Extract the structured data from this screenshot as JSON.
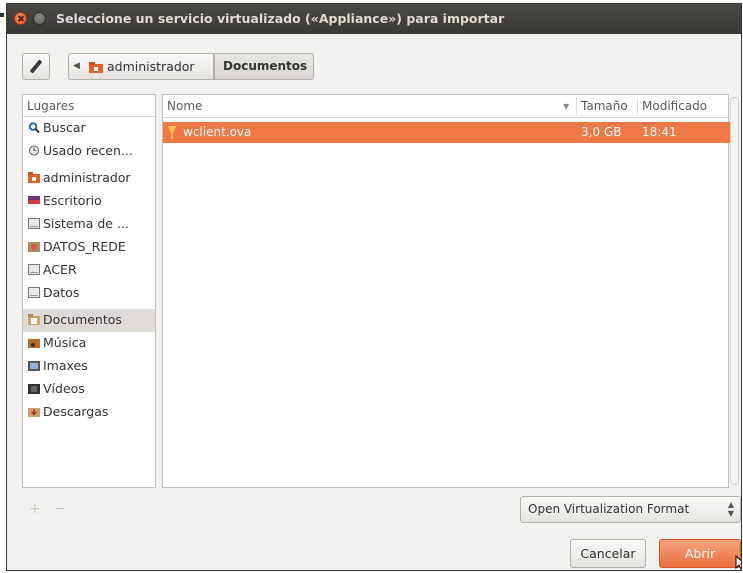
{
  "window": {
    "title": "Seleccione un servicio virtualizado («Appliance») para importar"
  },
  "pathbar": {
    "crumbs": [
      "administrador",
      "Documentos"
    ]
  },
  "sidebar": {
    "header": "Lugares",
    "items": [
      {
        "label": "Buscar",
        "icon": "search-icon"
      },
      {
        "label": "Usado recen...",
        "icon": "recent-icon"
      },
      {
        "label": "administrador",
        "icon": "home-folder-icon"
      },
      {
        "label": "Escritorio",
        "icon": "desktop-icon"
      },
      {
        "label": "Sistema de ...",
        "icon": "drive-icon"
      },
      {
        "label": "DATOS_REDE",
        "icon": "network-drive-icon"
      },
      {
        "label": "ACER",
        "icon": "drive-icon"
      },
      {
        "label": "Datos",
        "icon": "drive-icon"
      },
      {
        "label": "Documentos",
        "icon": "documents-folder-icon",
        "selected": true
      },
      {
        "label": "Música",
        "icon": "music-folder-icon"
      },
      {
        "label": "Imaxes",
        "icon": "pictures-folder-icon"
      },
      {
        "label": "Vídeos",
        "icon": "videos-folder-icon"
      },
      {
        "label": "Descargas",
        "icon": "downloads-folder-icon"
      }
    ]
  },
  "filelist": {
    "columns": {
      "name": "Nome",
      "size": "Tamaño",
      "modified": "Modificado"
    },
    "rows": [
      {
        "name": "wclient.ova",
        "size": "3,0 GB",
        "modified": "18:41",
        "selected": true
      }
    ]
  },
  "footer": {
    "filter": "Open Virtualization Format",
    "cancel": "Cancelar",
    "open": "Abrir"
  },
  "colors": {
    "accent": "#f07746",
    "titlebar": "#3c3b37",
    "window_bg": "#f2f1f0"
  }
}
